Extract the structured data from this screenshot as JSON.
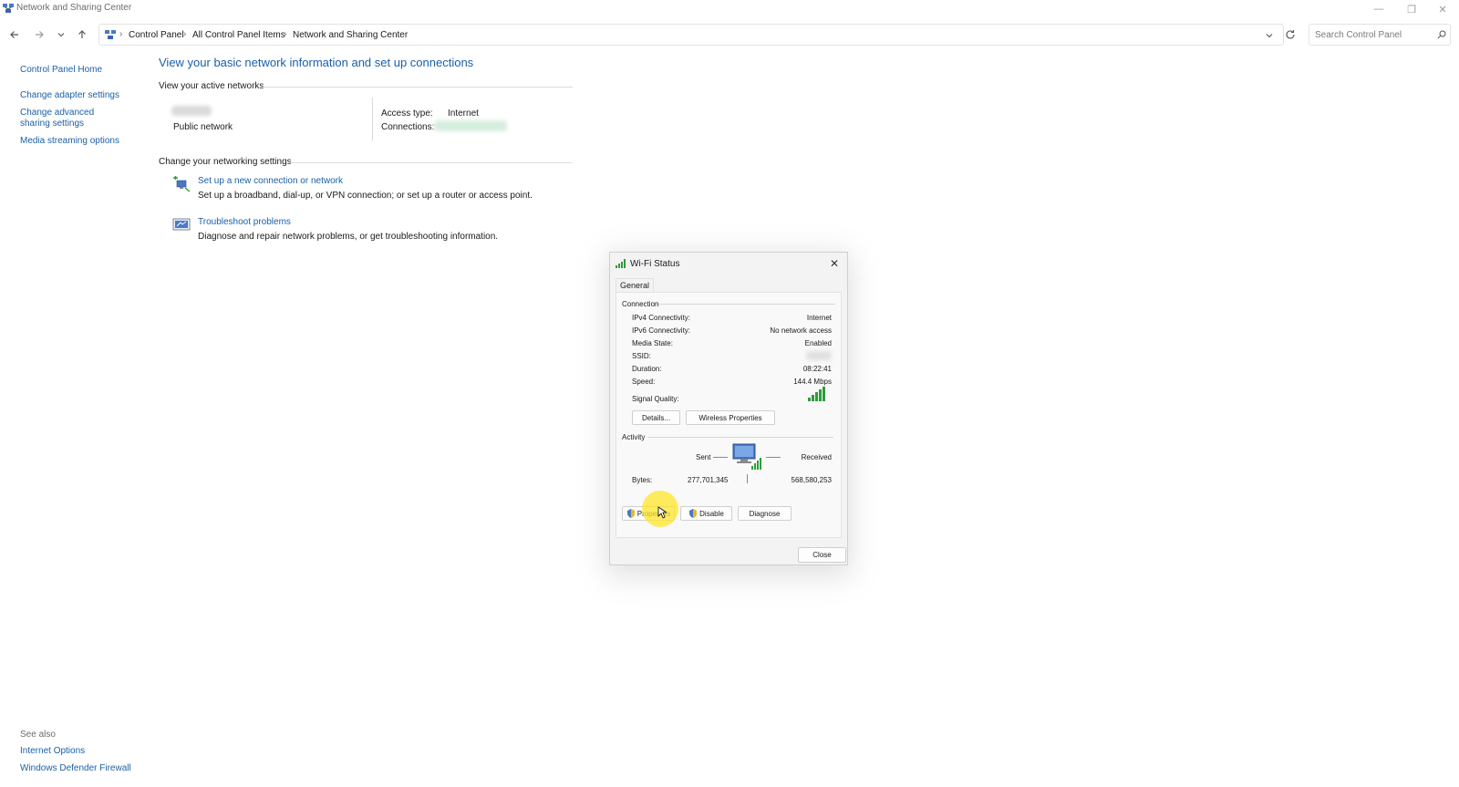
{
  "window": {
    "title": "Network and Sharing Center",
    "controls": {
      "minimize": "—",
      "restore": "❐",
      "close": "✕"
    }
  },
  "nav": {
    "back_icon": "back-arrow-icon",
    "forward_icon": "forward-arrow-icon",
    "recent_icon": "chevron-down-icon",
    "up_icon": "up-arrow-icon",
    "breadcrumbs": [
      "Control Panel",
      "All Control Panel Items",
      "Network and Sharing Center"
    ],
    "search_placeholder": "Search Control Panel"
  },
  "sidebar": {
    "items": [
      {
        "label": "Control Panel Home"
      },
      {
        "label": "Change adapter settings"
      },
      {
        "label": "Change advanced sharing settings"
      },
      {
        "label": "Media streaming options"
      }
    ],
    "see_also": "See also",
    "see_also_items": [
      {
        "label": "Internet Options"
      },
      {
        "label": "Windows Defender Firewall"
      }
    ]
  },
  "main": {
    "heading": "View your basic network information and set up connections",
    "active_networks_label": "View your active networks",
    "network_type": "Public network",
    "access_type_label": "Access type:",
    "access_type_value": "Internet",
    "connections_label": "Connections:",
    "change_settings_label": "Change your networking settings",
    "tasks": [
      {
        "title": "Set up a new connection or network",
        "desc": "Set up a broadband, dial-up, or VPN connection; or set up a router or access point."
      },
      {
        "title": "Troubleshoot problems",
        "desc": "Diagnose and repair network problems, or get troubleshooting information."
      }
    ]
  },
  "dialog": {
    "title": "Wi-Fi Status",
    "tab": "General",
    "connection_label": "Connection",
    "rows": [
      {
        "label": "IPv4 Connectivity:",
        "value": "Internet"
      },
      {
        "label": "IPv6 Connectivity:",
        "value": "No network access"
      },
      {
        "label": "Media State:",
        "value": "Enabled"
      },
      {
        "label": "SSID:",
        "value": ""
      },
      {
        "label": "Duration:",
        "value": "08:22:41"
      },
      {
        "label": "Speed:",
        "value": "144.4 Mbps"
      }
    ],
    "signal_label": "Signal Quality:",
    "details_button": "Details...",
    "wireless_button": "Wireless Properties",
    "activity_label": "Activity",
    "sent_label": "Sent",
    "received_label": "Received",
    "bytes_label": "Bytes:",
    "bytes_sent": "277,701,345",
    "bytes_received": "568,580,253",
    "properties_button": "Properties",
    "disable_button": "Disable",
    "diagnose_button": "Diagnose",
    "close_button": "Close"
  },
  "colors": {
    "link": "#1a5fa8",
    "signal": "#2e9c3a",
    "cursor_highlight": "#ffe628"
  }
}
